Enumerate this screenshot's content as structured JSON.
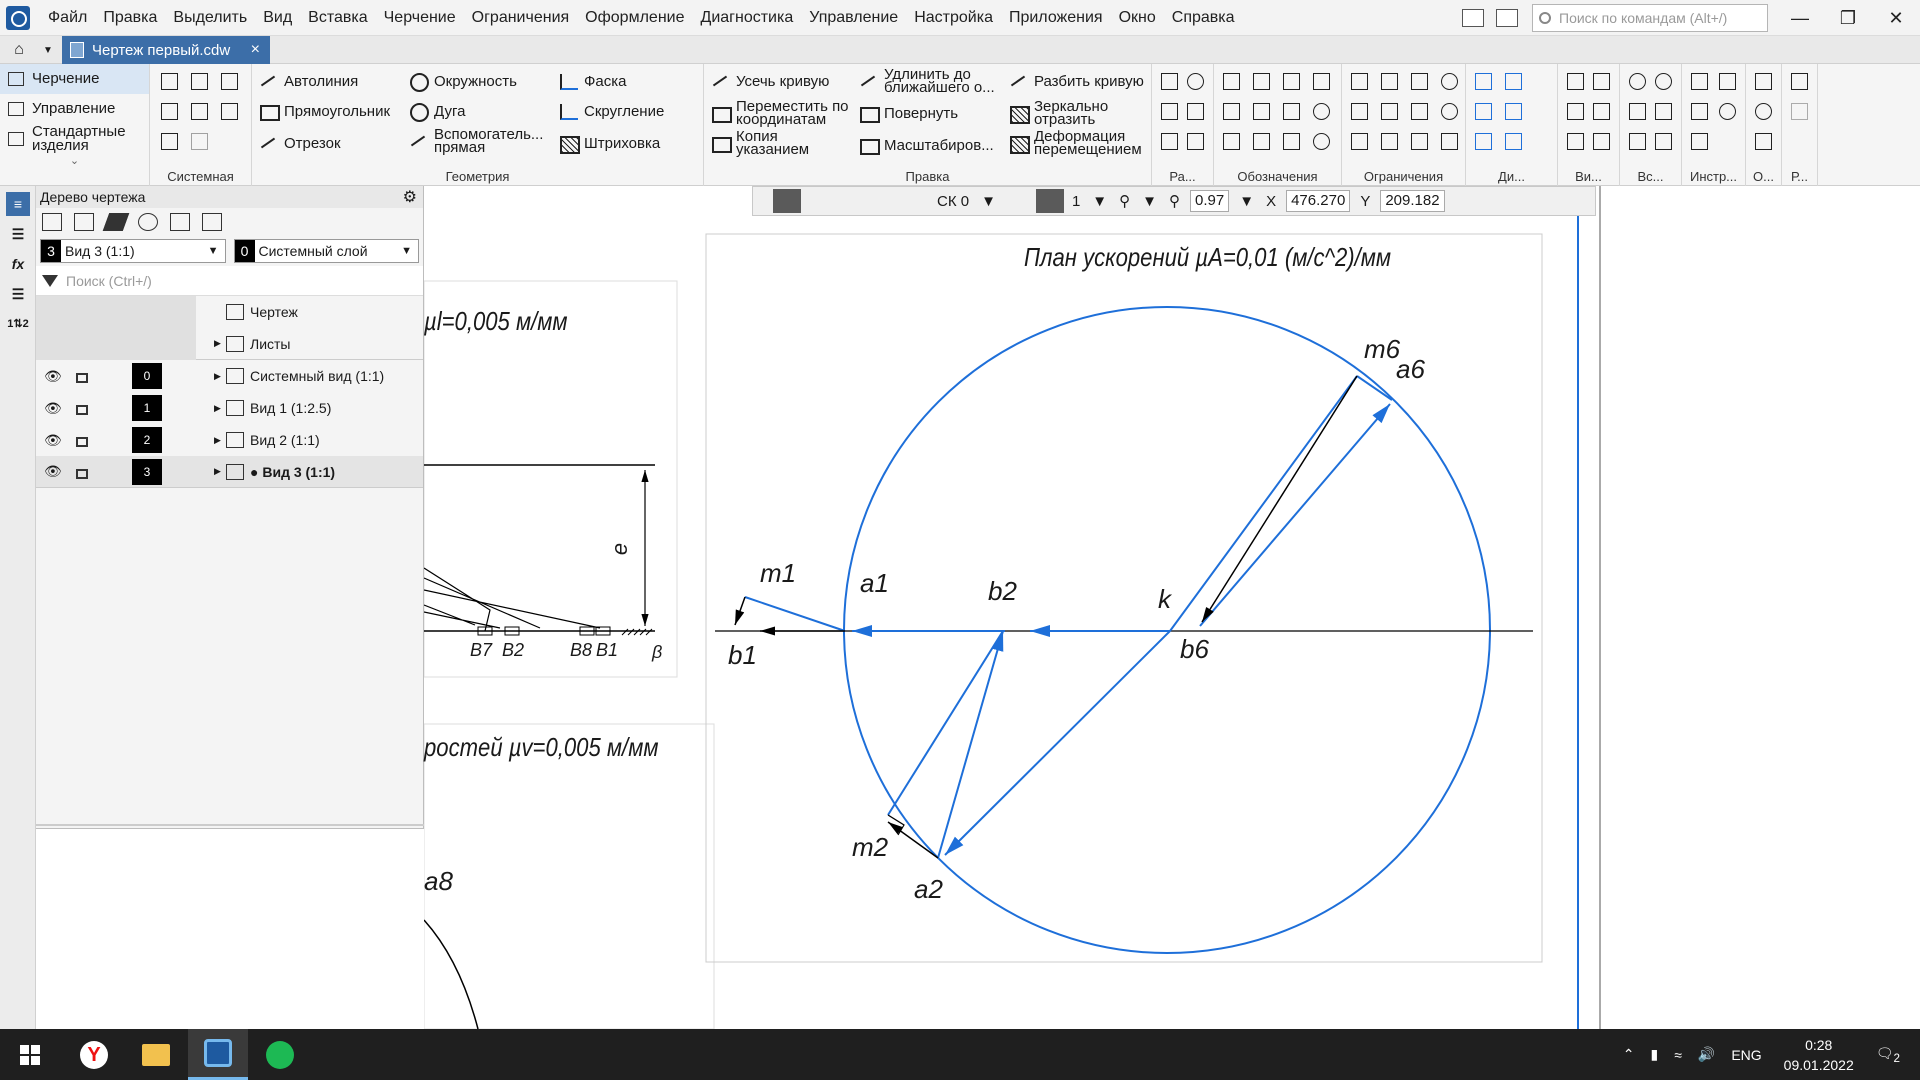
{
  "menu": {
    "items": [
      "Файл",
      "Правка",
      "Выделить",
      "Вид",
      "Вставка",
      "Черчение",
      "Ограничения",
      "Оформление",
      "Диагностика",
      "Управление",
      "Настройка",
      "Приложения",
      "Окно",
      "Справка"
    ],
    "search_placeholder": "Поиск по командам (Alt+/)"
  },
  "tab": {
    "title": "Чертеж первый.cdw",
    "close": "×"
  },
  "ribbon": {
    "nav": [
      "Черчение",
      "Управление",
      "Стандартные изделия"
    ],
    "groups": {
      "system": "Системная",
      "geometry": "Геометрия",
      "edit": "Правка",
      "ra": "Ра...",
      "marks": "Обозначения",
      "constraints": "Ограничения",
      "di": "Ди...",
      "vi": "Ви...",
      "vs": "Вс...",
      "instr": "Инстр...",
      "o": "О...",
      "r": "Р..."
    },
    "geometry_cmds": [
      "Автолиния",
      "Окружность",
      "Фаска",
      "Прямоугольник",
      "Дуга",
      "Скругление",
      "Отрезок",
      "Вспомогатель... прямая",
      "Штриховка"
    ],
    "edit_cmds": [
      "Усечь кривую",
      "Удлинить до ближайшего о...",
      "Разбить кривую",
      "Переместить по координатам",
      "Повернуть",
      "Зеркально отразить",
      "Копия указанием",
      "Масштабиров...",
      "Деформация перемещением"
    ]
  },
  "props_bar": {
    "sk": "СК 0",
    "layer_num": "1",
    "zoom": "0.97",
    "x_label": "X",
    "x_value": "476.270",
    "y_label": "Y",
    "y_value": "209.182"
  },
  "tree": {
    "title": "Дерево чертежа",
    "view_num": "3",
    "view_label": "Вид 3 (1:1)",
    "layer_num": "0",
    "layer_label": "Системный слой",
    "search_placeholder": "Поиск (Ctrl+/)",
    "root": "Чертеж",
    "sheets": "Листы",
    "rows": [
      {
        "num": "0",
        "label": "Системный вид (1:1)"
      },
      {
        "num": "1",
        "label": "Вид 1 (1:2.5)"
      },
      {
        "num": "2",
        "label": "Вид 2 (1:1)"
      },
      {
        "num": "3",
        "label": "● Вид 3 (1:1)"
      }
    ]
  },
  "drawing": {
    "title_accel": "План ускорений µA=0,01 (м/с^2)/мм",
    "title_scale_l": "µl=0,005 м/мм",
    "title_speed": "ростей µv=0,005 м/мм",
    "labels": {
      "m6": "m6",
      "a6": "a6",
      "m1": "m1",
      "a1": "a1",
      "b2": "b2",
      "k": "k",
      "b1": "b1",
      "b6": "b6",
      "m2": "m2",
      "a2": "a2",
      "e": "e",
      "B7": "B7",
      "B2": "B2",
      "B8": "B8",
      "B1": "B1",
      "beta": "β",
      "a8": "a8"
    },
    "colors": {
      "blue": "#1e6fd9",
      "black": "#000000"
    }
  },
  "taskbar": {
    "lang": "ENG",
    "time": "0:28",
    "date": "09.01.2022",
    "notif": "2"
  }
}
